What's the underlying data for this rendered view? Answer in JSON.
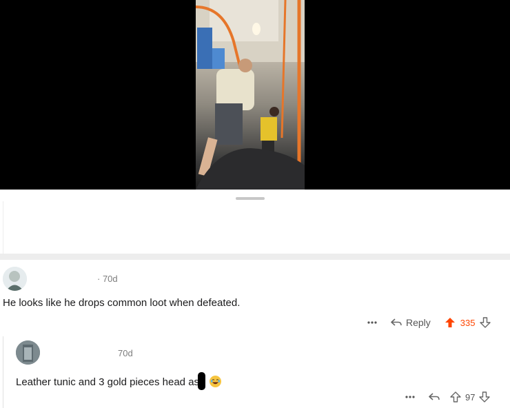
{
  "comment1": {
    "time": "· 70d",
    "body": "He looks like he drops common loot when defeated.",
    "reply_label": "Reply",
    "score": "335",
    "upvote_color": "#ff4500"
  },
  "comment2": {
    "time": "70d",
    "body": "Leather tunic and 3 gold pieces head as",
    "score": "97"
  },
  "icons": [
    "more-icon",
    "reply-icon",
    "upvote-icon",
    "downvote-icon",
    "laughing-emoji"
  ]
}
